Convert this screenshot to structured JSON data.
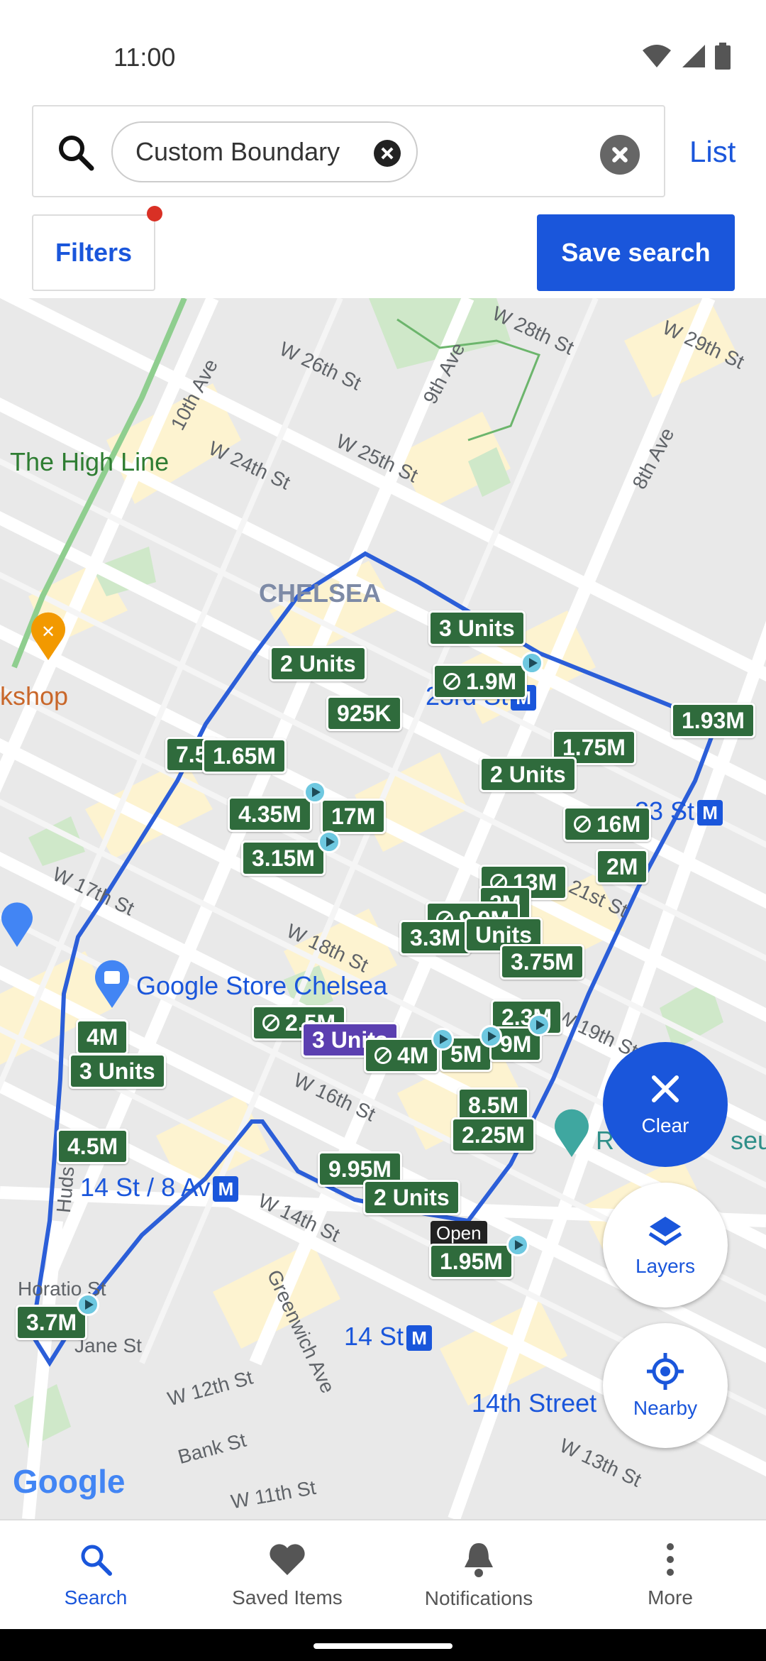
{
  "status": {
    "time": "11:00"
  },
  "search": {
    "chip_label": "Custom Boundary",
    "list_label": "List",
    "filters_label": "Filters",
    "save_label": "Save search"
  },
  "map": {
    "streets": [
      "W 28th St",
      "W 29th St",
      "W 26th St",
      "9th Ave",
      "10th Ave",
      "8th Ave",
      "W 24th St",
      "W 25th St",
      "W 17th St",
      "W 18th St",
      "W 16th St",
      "W 14th St",
      "W 19th St",
      "21st St",
      "Horatio St",
      "W 12th St",
      "Bank St",
      "W 11th St",
      "W 13th St",
      "Greenwich Ave",
      "Huds",
      "Jane St"
    ],
    "places": {
      "high_line": "The High Line",
      "chelsea": "CHELSEA",
      "google_store": "Google Store Chelsea",
      "bookshop": "kshop",
      "museum": "R",
      "museum_tail": "seum"
    },
    "stations": {
      "st23a": "23rd St",
      "st23b": "23 St",
      "st14_8av": "14 St / 8 Av",
      "st14": "14 St",
      "st14th": "14th Street"
    },
    "metro_glyph": "M",
    "pins": [
      "3 Units",
      "1.9M",
      "2 Units",
      "925K",
      "1.93M",
      "7.5",
      "1.65M",
      "1.75M",
      "2 Units",
      "4.35M",
      "17M",
      "16M",
      "3.15M",
      "2M",
      "13M",
      "2M",
      "3.3M",
      "Units",
      "3.75M",
      "2.3M",
      "4M",
      "2.5M",
      "3 Units",
      "4M",
      "5M",
      "9M",
      "3 Units",
      "8.5M",
      "4.5M",
      "2.25M",
      "9.95M",
      "2 Units",
      "1.95M",
      "3.7M",
      "9.9M"
    ],
    "open_label": "Open",
    "logo": "Google"
  },
  "fabs": {
    "clear": "Clear",
    "layers": "Layers",
    "nearby": "Nearby"
  },
  "nav": {
    "search": "Search",
    "saved": "Saved Items",
    "notifications": "Notifications",
    "more": "More"
  }
}
